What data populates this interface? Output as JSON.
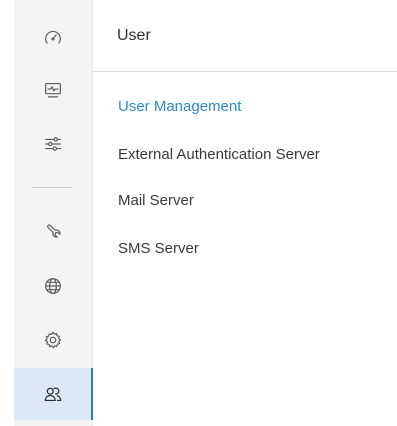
{
  "sidebar": {
    "items": [
      {
        "icon": "dashboard-gauge-icon",
        "active": false
      },
      {
        "icon": "monitor-pulse-icon",
        "active": false
      },
      {
        "icon": "sliders-icon",
        "active": false
      },
      {
        "icon": "wrench-icon",
        "active": false
      },
      {
        "icon": "globe-icon",
        "active": false
      },
      {
        "icon": "gear-icon",
        "active": false
      },
      {
        "icon": "users-icon",
        "active": true
      }
    ]
  },
  "panel": {
    "title": "User",
    "menu": [
      {
        "label": "User Management",
        "selected": true
      },
      {
        "label": "External Authentication Server",
        "selected": false
      },
      {
        "label": "Mail Server",
        "selected": false
      },
      {
        "label": "SMS Server",
        "selected": false
      }
    ]
  },
  "colors": {
    "accent": "#2f7dc0",
    "selected_text": "#2f8ac7",
    "sidebar_bg": "#f4f4f4",
    "active_bg": "#dbe8f5"
  }
}
